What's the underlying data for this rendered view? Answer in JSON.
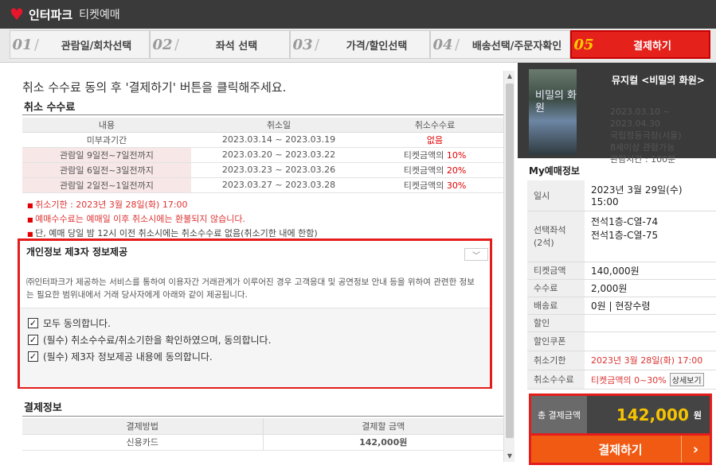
{
  "app": {
    "brand": "인터파크",
    "subtitle": "티켓예매"
  },
  "steps": [
    {
      "num": "01",
      "label": "관람일/회차선택",
      "active": false
    },
    {
      "num": "02",
      "label": "좌석 선택",
      "active": false
    },
    {
      "num": "03",
      "label": "가격/할인선택",
      "active": false
    },
    {
      "num": "04",
      "label": "배송선택/주문자확인",
      "active": false
    },
    {
      "num": "05",
      "label": "결제하기",
      "active": true
    }
  ],
  "left": {
    "headline": "취소 수수료 동의 후 '결제하기' 버튼을 클릭해주세요.",
    "cancel_section": "취소 수수료",
    "fee_table": {
      "headers": [
        "내용",
        "취소일",
        "취소수수료"
      ],
      "rows": [
        {
          "label": "미부과기간",
          "date": "2023.03.14 ~ 2023.03.19",
          "fee_prefix": "",
          "fee_value": "없음"
        },
        {
          "label": "관람일 9일전~7일전까지",
          "date": "2023.03.20 ~ 2023.03.22",
          "fee_prefix": "티켓금액의 ",
          "fee_value": "10%"
        },
        {
          "label": "관람일 6일전~3일전까지",
          "date": "2023.03.23 ~ 2023.03.26",
          "fee_prefix": "티켓금액의 ",
          "fee_value": "20%"
        },
        {
          "label": "관람일 2일전~1일전까지",
          "date": "2023.03.27 ~ 2023.03.28",
          "fee_prefix": "티켓금액의 ",
          "fee_value": "30%"
        }
      ]
    },
    "notes": [
      "취소기한 : 2023년 3월 28일(화) 17:00",
      "예매수수료는 예매일 이후 취소시에는 환불되지 않습니다.",
      "단, 예매 당일 밤 12시 이전 취소시에는 취소수수료 없음(취소기한 내에 한함)"
    ],
    "privacy": {
      "title": "개인정보 제3자 정보제공",
      "description": "㈜인터파크가 제공하는 서비스를 통하여 이용자간 거래관계가 이루어진 경우 고객응대 및 공연정보 안내 등을 위하여 관련한 정보는 필요한 범위내에서 거래 당사자에게 아래와 같이 제공됩니다.",
      "checks": [
        "모두 동의합니다.",
        "(필수) 취소수수료/취소기한을 확인하였으며, 동의합니다.",
        "(필수) 제3자 정보제공 내용에 동의합니다."
      ]
    },
    "payment_section": "결제정보",
    "payment_table": {
      "headers": [
        "결제방법",
        "결제할 금액"
      ],
      "method": "신용카드",
      "amount": "142,000원"
    }
  },
  "right": {
    "show_title": "뮤지컬 <비밀의 화원>",
    "poster_text": "비밀의 화원",
    "show_info": [
      "2023.03.10 ~",
      "2023.04.30",
      "국립정동극장(서울)",
      "8세이상 관람가능",
      "관람시간 : 100분"
    ],
    "my_title": "My예매정보",
    "rows": {
      "date_key": "일시",
      "date_val1": "2023년 3월 29일(수)",
      "date_val2": "15:00",
      "seat_key1": "선택좌석",
      "seat_key2": "(2석)",
      "seat_val1": "전석1층-C열-74",
      "seat_val2": "전석1층-C열-75",
      "ticket_key": "티켓금액",
      "ticket_val": "140,000원",
      "fee_key": "수수료",
      "fee_val": "2,000원",
      "delivery_key": "배송료",
      "delivery_val": "0원 | 현장수령",
      "discount_key": "할인",
      "discount_val": "",
      "coupon_key": "할인쿠폰",
      "coupon_val": "",
      "deadline_key": "취소기한",
      "deadline_val": "2023년 3월 28일(화) 17:00",
      "cancelfee_key": "취소수수료",
      "cancelfee_val": "티켓금액의 0~30%",
      "detail_btn": "상세보기"
    },
    "total_label": "총 결제금액",
    "total_value": "142,000",
    "total_unit": "원",
    "pay_button": "결제하기"
  },
  "colors": {
    "accent": "#e5211c",
    "pay_button": "#f05a12",
    "total_amount": "#f6c400"
  }
}
